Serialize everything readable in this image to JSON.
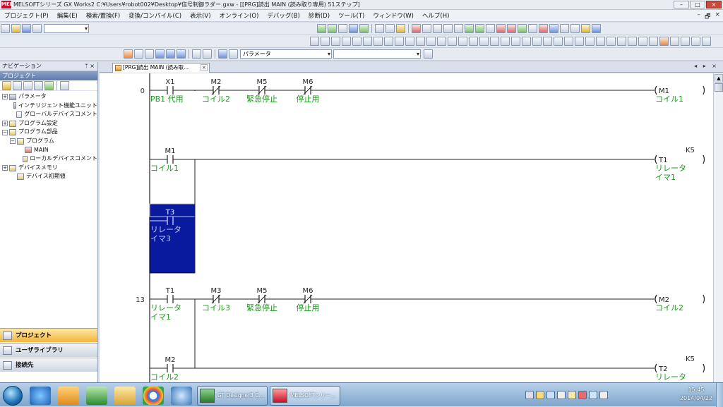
{
  "window": {
    "title": "MELSOFTシリーズ GX Works2 C:¥Users¥robot002¥Desktop¥信号制御ラダー.gxw - [[PRG]読出 MAIN (読み取り専用) 51ステップ]",
    "logo_text": "MEL",
    "buttons": [
      "–",
      "□",
      "×"
    ]
  },
  "menubar": {
    "items": [
      "プロジェクト(P)",
      "編集(E)",
      "検索/置換(F)",
      "変換/コンパイル(C)",
      "表示(V)",
      "オンライン(O)",
      "デバッグ(B)",
      "診断(D)",
      "ツール(T)",
      "ウィンドウ(W)",
      "ヘルプ(H)"
    ],
    "mdi_buttons": [
      "–",
      "🗗",
      "×"
    ]
  },
  "toolbar": {
    "combo_parameter": "パラメータ"
  },
  "navigation": {
    "header": "ナビゲーション",
    "pin": "ᛘ ×",
    "section": "プロジェクト",
    "tree": [
      {
        "label": "パラメータ",
        "expander": "+",
        "indent": 0,
        "icon": "sys"
      },
      {
        "label": "インテリジェント機能ユニット",
        "expander": "",
        "indent": 1,
        "icon": "sys"
      },
      {
        "label": "グローバルデバイスコメント",
        "expander": "",
        "indent": 1,
        "icon": "doc"
      },
      {
        "label": "プログラム設定",
        "expander": "+",
        "indent": 0,
        "icon": "fold"
      },
      {
        "label": "プログラム部品",
        "expander": "−",
        "indent": 0,
        "icon": "fold"
      },
      {
        "label": "プログラム",
        "expander": "−",
        "indent": 1,
        "icon": "fold"
      },
      {
        "label": "MAIN",
        "expander": "",
        "indent": 2,
        "icon": "prg"
      },
      {
        "label": "ローカルデバイスコメント",
        "expander": "",
        "indent": 2,
        "icon": "fold"
      },
      {
        "label": "デバイスメモリ",
        "expander": "+",
        "indent": 0,
        "icon": "fold"
      },
      {
        "label": "デバイス初期値",
        "expander": "",
        "indent": 1,
        "icon": "fold"
      }
    ],
    "bottom_buttons": [
      {
        "label": "プロジェクト",
        "active": true
      },
      {
        "label": "ユーザライブラリ",
        "active": false
      },
      {
        "label": "接続先",
        "active": false
      }
    ]
  },
  "tab": {
    "label": "[PRG]読出 MAIN (読み取...",
    "close": "×",
    "arrows": "◂ ▸ ×"
  },
  "ladder": {
    "step_numbers": [
      "0",
      "13"
    ],
    "rungs": [
      {
        "contacts": [
          {
            "device": "X1",
            "comment": "PB1 代用",
            "type": "NO"
          },
          {
            "device": "M2",
            "comment": "コイル2",
            "type": "NC"
          },
          {
            "device": "M5",
            "comment": "緊急停止",
            "type": "NC"
          },
          {
            "device": "M6",
            "comment": "停止用",
            "type": "NC"
          }
        ],
        "coil": {
          "device": "M1",
          "comment": "コイル1",
          "setting": ""
        }
      },
      {
        "contacts": [
          {
            "device": "M1",
            "comment": "コイル1",
            "type": "NO"
          }
        ],
        "coil": {
          "device": "T1",
          "comment": "リレータ イマ1",
          "setting": "K5"
        }
      },
      {
        "contacts": [
          {
            "device": "T3",
            "comment": "リレータ イマ3",
            "type": "NO",
            "selected": true
          }
        ],
        "coil": null
      },
      {
        "contacts": [
          {
            "device": "T1",
            "comment": "リレータ イマ1",
            "type": "NO"
          },
          {
            "device": "M3",
            "comment": "コイル3",
            "type": "NC"
          },
          {
            "device": "M5",
            "comment": "緊急停止",
            "type": "NC"
          },
          {
            "device": "M6",
            "comment": "停止用",
            "type": "NC"
          }
        ],
        "coil": {
          "device": "M2",
          "comment": "コイル2",
          "setting": ""
        }
      },
      {
        "contacts": [
          {
            "device": "M2",
            "comment": "コイル2",
            "type": "NO"
          }
        ],
        "coil": {
          "device": "T2",
          "comment": "リレータ",
          "setting": "K5"
        }
      }
    ],
    "colors": {
      "comment": "#1a9a1a",
      "line": "#222222",
      "selection": "#0a1a9e"
    }
  },
  "taskbar": {
    "windows": [
      {
        "label": "GT Designer3 C..."
      },
      {
        "label": "MELSOFTシリー..."
      }
    ],
    "clock_time": "15:45",
    "clock_date": "2014/04/22"
  }
}
